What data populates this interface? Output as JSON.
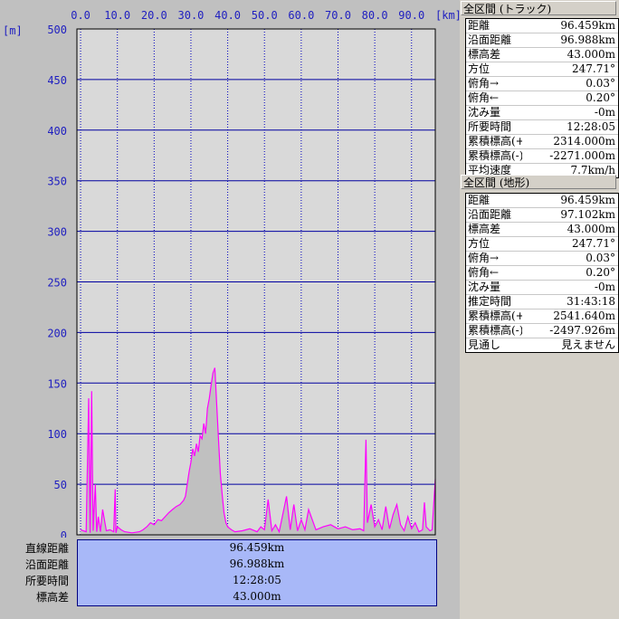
{
  "chart_data": {
    "type": "area",
    "xlabel": "",
    "ylabel": "",
    "x_unit": "[km]",
    "y_unit": "[m]",
    "xlim": [
      -1,
      96.459
    ],
    "ylim": [
      0,
      500
    ],
    "x_ticks": [
      "0.0",
      "10.0",
      "20.0",
      "30.0",
      "40.0",
      "50.0",
      "60.0",
      "70.0",
      "80.0",
      "90.0"
    ],
    "y_ticks": [
      "500",
      "450",
      "400",
      "350",
      "300",
      "250",
      "200",
      "150",
      "100",
      "50",
      "0"
    ],
    "grid": true,
    "fill_color": "#c0c0c0",
    "line_color": "#ff00ff",
    "series": [
      {
        "x": [
          0,
          1.5,
          2.2,
          2.6,
          3.0,
          3.4,
          4.0,
          4.4,
          4.8,
          5.4,
          6.0,
          7.0,
          8.0,
          9.0,
          9.4,
          9.6,
          10.0,
          11.0,
          12.0,
          14.0,
          16.0,
          17.0,
          18.0,
          19.0,
          20.0,
          21.0,
          22.0,
          23.0,
          24.0,
          25.0,
          26.0,
          27.0,
          28.0,
          28.5,
          29.0,
          29.5,
          30.0,
          30.5,
          31.0,
          31.5,
          32.0,
          32.5,
          33.0,
          33.5,
          34.0,
          34.5,
          35.0,
          35.5,
          36.0,
          36.5,
          37.0,
          37.5,
          38.0,
          38.5,
          39.0,
          39.5,
          40.0,
          41.0,
          42.0,
          44.0,
          46.0,
          48.0,
          49.0,
          50.0,
          51.0,
          52.0,
          53.0,
          54.0,
          56.0,
          57.0,
          58.0,
          59.0,
          60.0,
          61.0,
          62.0,
          64.0,
          66.0,
          68.0,
          70.0,
          72.0,
          74.0,
          76.0,
          77.0,
          77.6,
          78.0,
          79.0,
          80.0,
          81.0,
          82.0,
          83.0,
          84.0,
          85.0,
          86.0,
          87.0,
          88.0,
          89.0,
          90.0,
          91.0,
          92.0,
          93.0,
          93.5,
          94.0,
          95.0,
          95.6,
          96.459
        ],
        "y": [
          5,
          3,
          135,
          2,
          142,
          4,
          50,
          3,
          18,
          3,
          25,
          4,
          5,
          3,
          45,
          2,
          8,
          5,
          3,
          2,
          3,
          5,
          8,
          12,
          10,
          15,
          14,
          18,
          22,
          25,
          28,
          30,
          34,
          38,
          50,
          62,
          72,
          85,
          78,
          90,
          82,
          98,
          95,
          110,
          100,
          125,
          135,
          148,
          160,
          165,
          130,
          95,
          60,
          40,
          22,
          12,
          8,
          5,
          3,
          4,
          6,
          3,
          8,
          5,
          35,
          4,
          10,
          3,
          38,
          5,
          30,
          4,
          15,
          5,
          25,
          5,
          8,
          10,
          6,
          8,
          5,
          6,
          4,
          94,
          12,
          30,
          8,
          15,
          5,
          28,
          6,
          20,
          30,
          10,
          4,
          18,
          6,
          12,
          3,
          5,
          32,
          8,
          4,
          5,
          55
        ]
      }
    ]
  },
  "bottom": {
    "rows": [
      {
        "label": "直線距離",
        "value": "96.459km"
      },
      {
        "label": "沿面距離",
        "value": "96.988km"
      },
      {
        "label": "所要時間",
        "value": "12:28:05"
      },
      {
        "label": "標高差",
        "value": "43.000m"
      }
    ]
  },
  "panel_track": {
    "title": "全区間 (トラック)",
    "rows": [
      {
        "key": "距離",
        "value": "96.459km"
      },
      {
        "key": "沿面距離",
        "value": "96.988km"
      },
      {
        "key": "標高差",
        "value": "43.000m"
      },
      {
        "key": "方位",
        "value": "247.71°"
      },
      {
        "key": "俯角→",
        "value": "0.03°"
      },
      {
        "key": "俯角←",
        "value": "0.20°"
      },
      {
        "key": "沈み量",
        "value": "-0m"
      },
      {
        "key": "所要時間",
        "value": "12:28:05"
      },
      {
        "key": "累積標高(+)",
        "value": "2314.000m"
      },
      {
        "key": "累積標高(-)",
        "value": "-2271.000m"
      },
      {
        "key": "平均速度",
        "value": "7.7km/h"
      }
    ]
  },
  "panel_terrain": {
    "title": "全区間 (地形)",
    "rows": [
      {
        "key": "距離",
        "value": "96.459km"
      },
      {
        "key": "沿面距離",
        "value": "97.102km"
      },
      {
        "key": "標高差",
        "value": "43.000m"
      },
      {
        "key": "方位",
        "value": "247.71°"
      },
      {
        "key": "俯角→",
        "value": "0.03°"
      },
      {
        "key": "俯角←",
        "value": "0.20°"
      },
      {
        "key": "沈み量",
        "value": "-0m"
      },
      {
        "key": "推定時間",
        "value": "31:43:18"
      },
      {
        "key": "累積標高(+)",
        "value": "2541.640m"
      },
      {
        "key": "累積標高(-)",
        "value": "-2497.926m"
      },
      {
        "key": "見通し",
        "value": "見えません"
      }
    ]
  }
}
